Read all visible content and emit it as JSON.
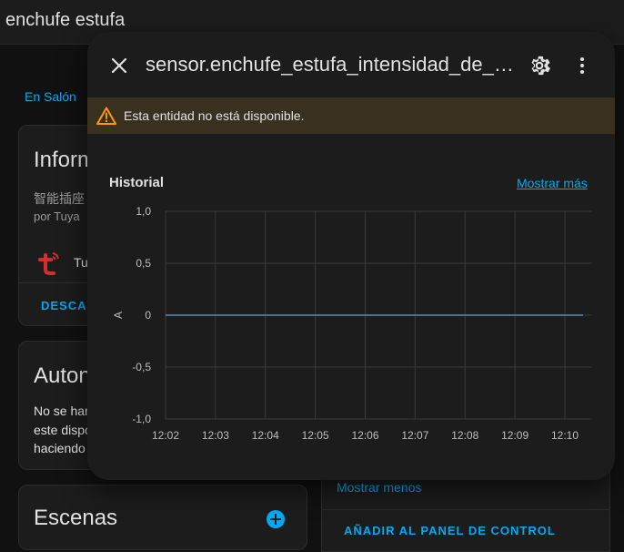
{
  "page": {
    "title": "enchufe estufa",
    "area_link": "En Salón"
  },
  "info_card": {
    "title": "Inform",
    "model": "智能插座",
    "manufacturer": "por Tuya",
    "integration": "Tu",
    "action": "DESCAR"
  },
  "automation_card": {
    "title": "Auton",
    "text": "No se han\neste dispo\nhaciendo"
  },
  "scenes_card": {
    "title": "Escenas"
  },
  "right_card": {
    "show_less": "Mostrar menos",
    "add_to_panel": "AÑADIR AL PANEL DE CONTROL"
  },
  "dialog": {
    "title": "sensor.enchufe_estufa_intensidad_de_corriente",
    "warning": "Esta entidad no está disponible.",
    "history_title": "Historial",
    "show_more": "Mostrar más"
  },
  "colors": {
    "accent": "#03a9f4",
    "warning_bg": "#3a3020",
    "warning_icon": "#ff9800",
    "line": "#4a90c8"
  },
  "chart_data": {
    "type": "line",
    "ylabel": "A",
    "ylim": [
      -1.0,
      1.0
    ],
    "yticks": [
      "-1,0",
      "-0,5",
      "0",
      "0,5",
      "1,0"
    ],
    "ytick_values": [
      -1.0,
      -0.5,
      0,
      0.5,
      1.0
    ],
    "xticks": [
      "12:02",
      "12:03",
      "12:04",
      "12:05",
      "12:06",
      "12:07",
      "12:08",
      "12:09",
      "12:10"
    ],
    "series": [
      {
        "x_start": "12:02",
        "x_end": "12:10",
        "values": [
          0,
          0
        ]
      }
    ],
    "grid": true
  }
}
